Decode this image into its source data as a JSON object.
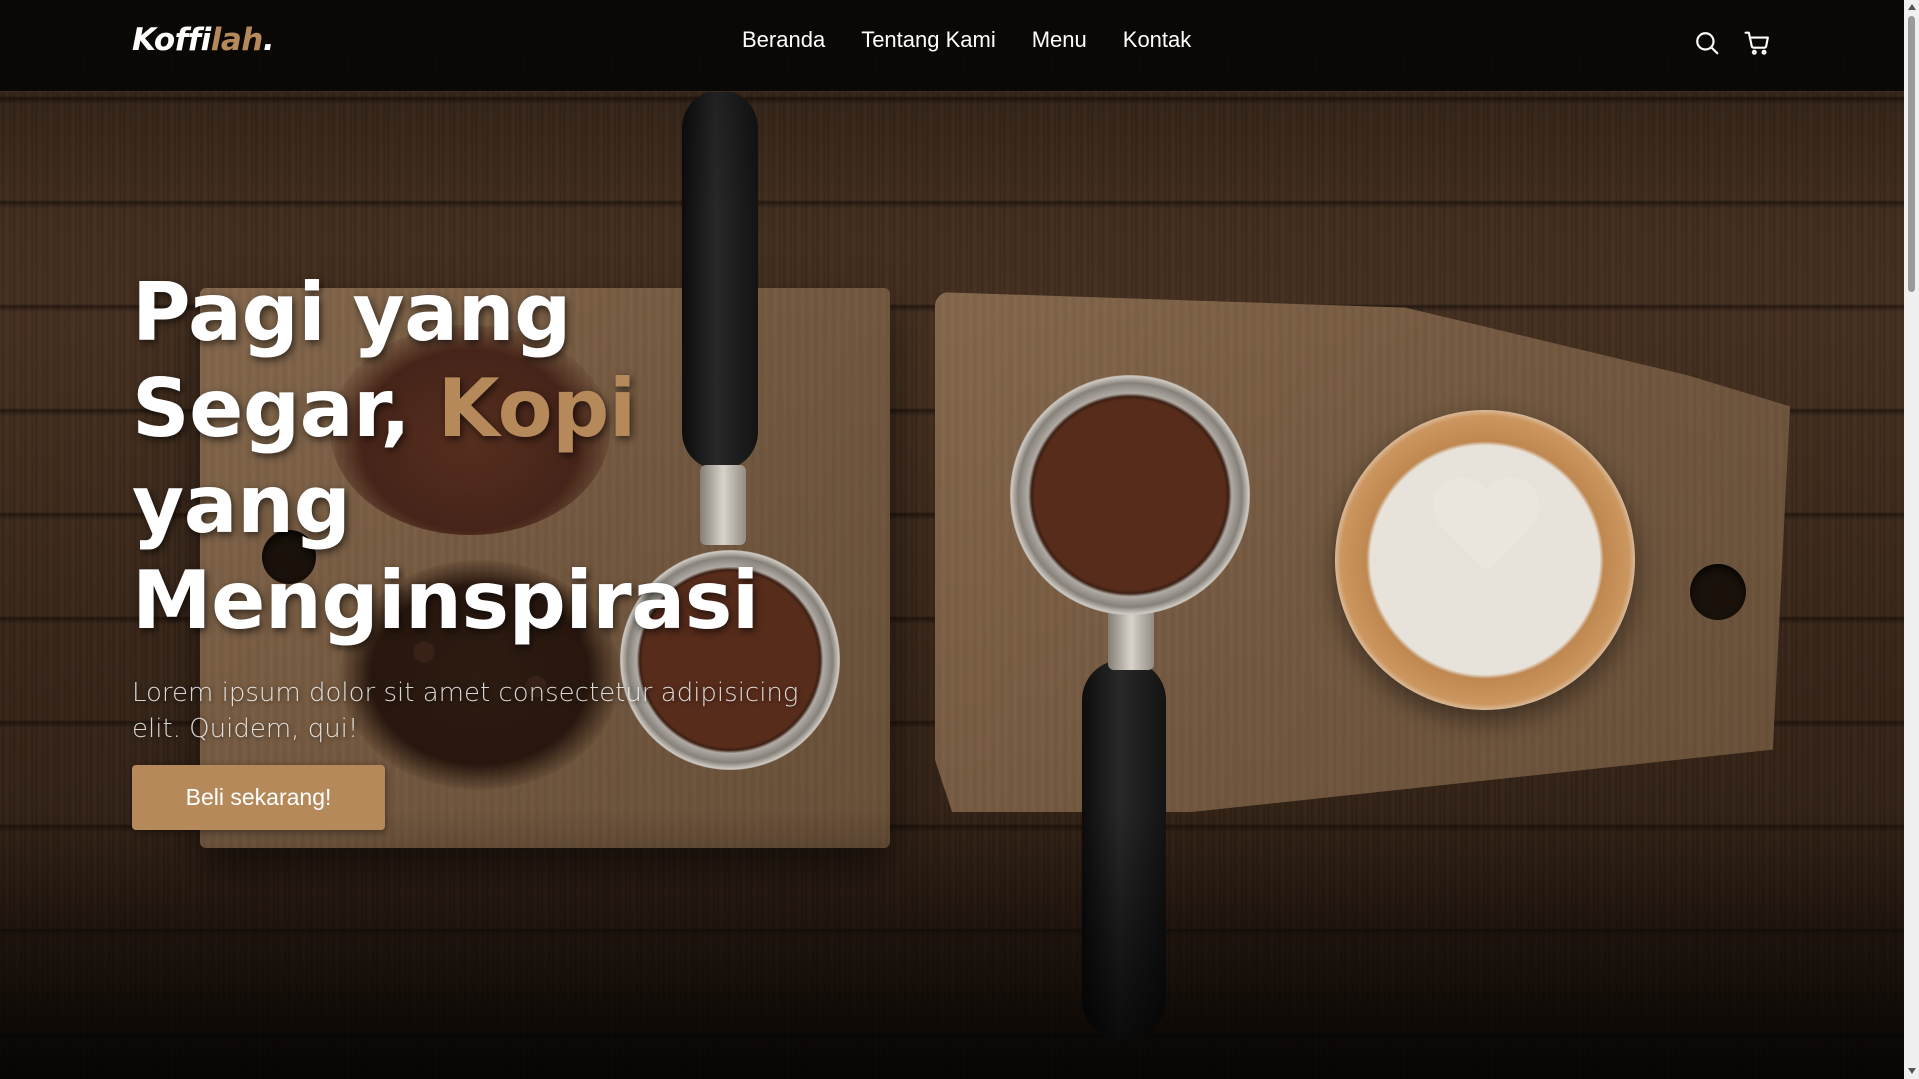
{
  "navbar": {
    "logo_main": "Koffi",
    "logo_accent": "lah",
    "logo_dot": ".",
    "links": [
      {
        "label": "Beranda"
      },
      {
        "label": "Tentang Kami"
      },
      {
        "label": "Menu"
      },
      {
        "label": "Kontak"
      }
    ],
    "icons": [
      "search-icon",
      "shopping-cart-icon"
    ]
  },
  "hero": {
    "headline_line1": "Pagi yang",
    "headline_line2_start": "Segar, ",
    "headline_line2_accent": "Kopi",
    "headline_line3": "yang",
    "headline_line4": "Menginspirasi",
    "subtitle": "Lorem ipsum dolor sit amet consectetur adipisicing elit. Quidem, qui!",
    "cta_label": "Beli sekarang!"
  },
  "colors": {
    "accent": "#b6895b",
    "navbar_bg": "#080604",
    "text": "#ffffff"
  }
}
